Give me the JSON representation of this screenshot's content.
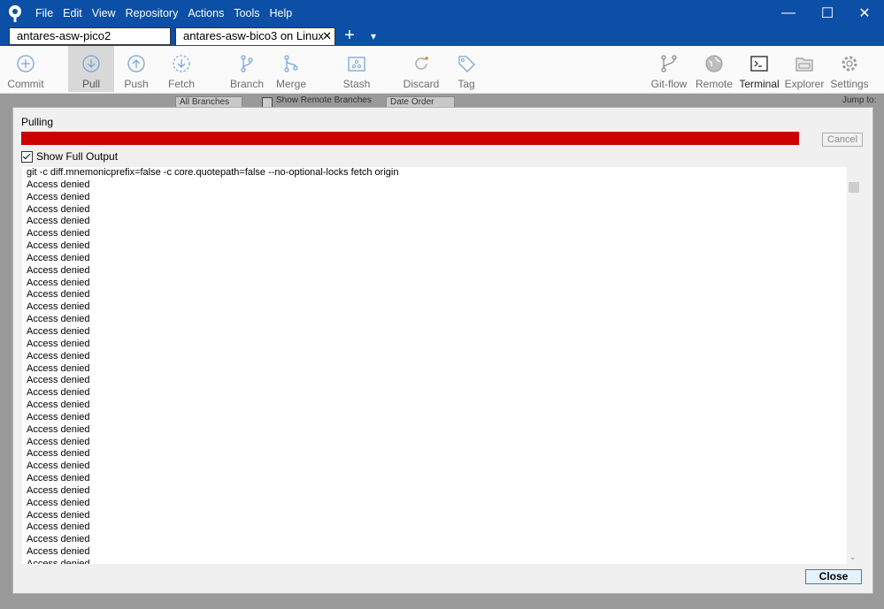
{
  "menu": [
    "File",
    "Edit",
    "View",
    "Repository",
    "Actions",
    "Tools",
    "Help"
  ],
  "window_controls": {
    "minimize": "—",
    "maximize": "☐",
    "close": "✕"
  },
  "tabs": [
    {
      "label": "antares-asw-pico2"
    },
    {
      "label": "antares-asw-bico3 on Linux",
      "close": "✕"
    }
  ],
  "tab_actions": {
    "add": "+",
    "dropdown": "▾"
  },
  "toolbar": {
    "commit": "Commit",
    "pull": "Pull",
    "push": "Push",
    "fetch": "Fetch",
    "branch": "Branch",
    "merge": "Merge",
    "stash": "Stash",
    "discard": "Discard",
    "tag": "Tag",
    "gitflow": "Git-flow",
    "remote": "Remote",
    "terminal": "Terminal",
    "explorer": "Explorer",
    "settings": "Settings"
  },
  "background": {
    "all_branches": "All Branches",
    "show_remote": "Show Remote Branches",
    "date_order": "Date Order",
    "jump_to": "Jump to:"
  },
  "dialog": {
    "title": "Pulling",
    "progress_color": "#cc0000",
    "cancel": "Cancel",
    "show_full_output": "Show Full Output",
    "close": "Close",
    "output_lines": [
      "git -c diff.mnemonicprefix=false -c core.quotepath=false --no-optional-locks fetch origin",
      "Access denied",
      "Access denied",
      "Access denied",
      "Access denied",
      "Access denied",
      "Access denied",
      "Access denied",
      "Access denied",
      "Access denied",
      "Access denied",
      "Access denied",
      "Access denied",
      "Access denied",
      "Access denied",
      "Access denied",
      "Access denied",
      "Access denied",
      "Access denied",
      "Access denied",
      "Access denied",
      "Access denied",
      "Access denied",
      "Access denied",
      "Access denied",
      "Access denied",
      "Access denied",
      "Access denied",
      "Access denied",
      "Access denied",
      "Access denied",
      "Access denied",
      "Access denied"
    ]
  }
}
